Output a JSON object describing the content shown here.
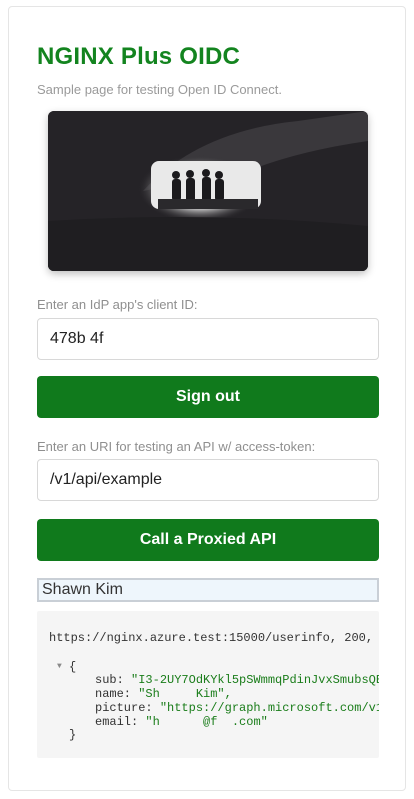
{
  "app": {
    "title": "NGINX Plus OIDC",
    "subtitle": "Sample page for testing Open ID Connect."
  },
  "client": {
    "label": "Enter an IdP app's client ID:",
    "value": "478b                                          4f"
  },
  "signout": {
    "label": "Sign out"
  },
  "api": {
    "label": "Enter an URI for testing an API w/ access-token:",
    "value": "/v1/api/example",
    "button_label": "Call a Proxied API"
  },
  "user": {
    "name": "Shawn Kim"
  },
  "userinfo": {
    "header": "https://nginx.azure.test:15000/userinfo, 200,",
    "toggle": "▼",
    "open_brace": "{",
    "sub_key": "sub: ",
    "sub_value": "\"I3-2UY7OdKYkl5pSWmmqPdinJvxSmubsQE",
    "name_key": "name: ",
    "name_value": "\"Sh     Kim\",",
    "picture_key": "picture: ",
    "picture_value": "\"https://graph.microsoft.com/v1",
    "email_key": "email: ",
    "email_value": "\"h      @f  .com\"",
    "close_brace": "}"
  },
  "colors": {
    "brand_green": "#13841f",
    "button_green": "#107a1c"
  }
}
